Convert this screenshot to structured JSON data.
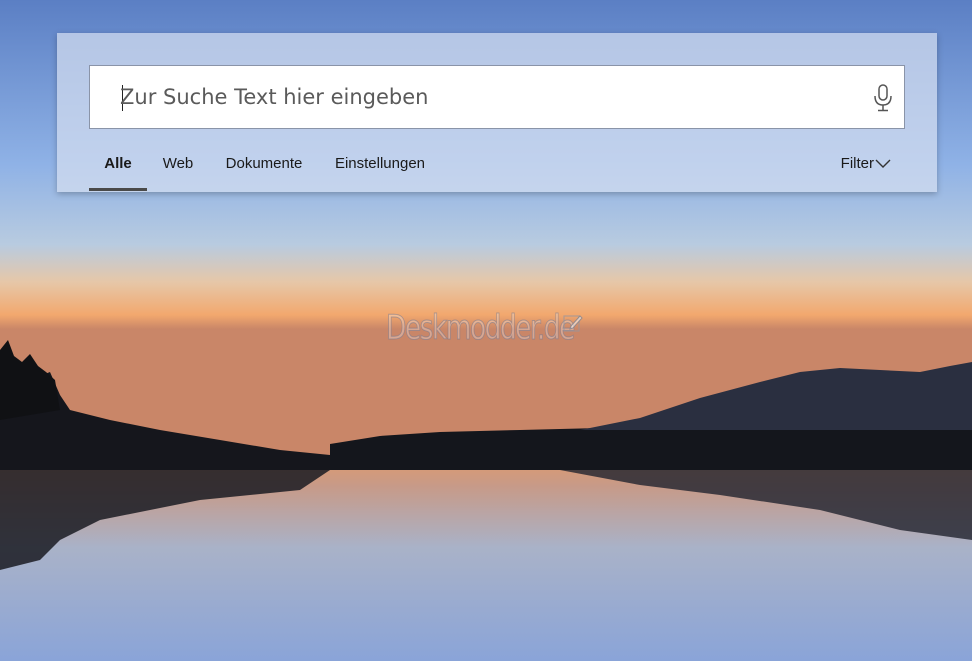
{
  "search": {
    "placeholder": "Zur Suche Text hier eingeben",
    "value": ""
  },
  "tabs": [
    {
      "label": "Alle",
      "active": true
    },
    {
      "label": "Web",
      "active": false
    },
    {
      "label": "Dokumente",
      "active": false
    },
    {
      "label": "Einstellungen",
      "active": false
    }
  ],
  "filter": {
    "label": "Filter",
    "icon": "chevron-down-icon"
  },
  "watermark": {
    "text": "Deskmodder.de"
  },
  "icons": {
    "mic": "microphone-icon"
  },
  "colors": {
    "panel": "#d4def0",
    "active_indicator": "#4a4a4a",
    "text": "#1a1a1a"
  }
}
